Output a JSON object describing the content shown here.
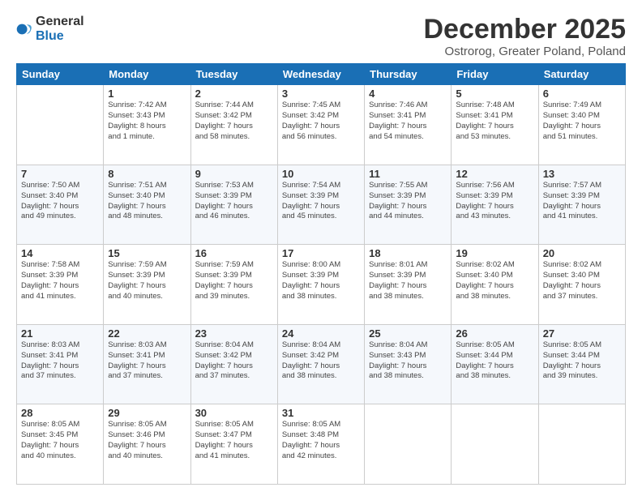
{
  "logo": {
    "general": "General",
    "blue": "Blue"
  },
  "title": "December 2025",
  "subtitle": "Ostrorog, Greater Poland, Poland",
  "days_of_week": [
    "Sunday",
    "Monday",
    "Tuesday",
    "Wednesday",
    "Thursday",
    "Friday",
    "Saturday"
  ],
  "weeks": [
    [
      {
        "day": "",
        "info": ""
      },
      {
        "day": "1",
        "info": "Sunrise: 7:42 AM\nSunset: 3:43 PM\nDaylight: 8 hours\nand 1 minute."
      },
      {
        "day": "2",
        "info": "Sunrise: 7:44 AM\nSunset: 3:42 PM\nDaylight: 7 hours\nand 58 minutes."
      },
      {
        "day": "3",
        "info": "Sunrise: 7:45 AM\nSunset: 3:42 PM\nDaylight: 7 hours\nand 56 minutes."
      },
      {
        "day": "4",
        "info": "Sunrise: 7:46 AM\nSunset: 3:41 PM\nDaylight: 7 hours\nand 54 minutes."
      },
      {
        "day": "5",
        "info": "Sunrise: 7:48 AM\nSunset: 3:41 PM\nDaylight: 7 hours\nand 53 minutes."
      },
      {
        "day": "6",
        "info": "Sunrise: 7:49 AM\nSunset: 3:40 PM\nDaylight: 7 hours\nand 51 minutes."
      }
    ],
    [
      {
        "day": "7",
        "info": "Sunrise: 7:50 AM\nSunset: 3:40 PM\nDaylight: 7 hours\nand 49 minutes."
      },
      {
        "day": "8",
        "info": "Sunrise: 7:51 AM\nSunset: 3:40 PM\nDaylight: 7 hours\nand 48 minutes."
      },
      {
        "day": "9",
        "info": "Sunrise: 7:53 AM\nSunset: 3:39 PM\nDaylight: 7 hours\nand 46 minutes."
      },
      {
        "day": "10",
        "info": "Sunrise: 7:54 AM\nSunset: 3:39 PM\nDaylight: 7 hours\nand 45 minutes."
      },
      {
        "day": "11",
        "info": "Sunrise: 7:55 AM\nSunset: 3:39 PM\nDaylight: 7 hours\nand 44 minutes."
      },
      {
        "day": "12",
        "info": "Sunrise: 7:56 AM\nSunset: 3:39 PM\nDaylight: 7 hours\nand 43 minutes."
      },
      {
        "day": "13",
        "info": "Sunrise: 7:57 AM\nSunset: 3:39 PM\nDaylight: 7 hours\nand 41 minutes."
      }
    ],
    [
      {
        "day": "14",
        "info": "Sunrise: 7:58 AM\nSunset: 3:39 PM\nDaylight: 7 hours\nand 41 minutes."
      },
      {
        "day": "15",
        "info": "Sunrise: 7:59 AM\nSunset: 3:39 PM\nDaylight: 7 hours\nand 40 minutes."
      },
      {
        "day": "16",
        "info": "Sunrise: 7:59 AM\nSunset: 3:39 PM\nDaylight: 7 hours\nand 39 minutes."
      },
      {
        "day": "17",
        "info": "Sunrise: 8:00 AM\nSunset: 3:39 PM\nDaylight: 7 hours\nand 38 minutes."
      },
      {
        "day": "18",
        "info": "Sunrise: 8:01 AM\nSunset: 3:39 PM\nDaylight: 7 hours\nand 38 minutes."
      },
      {
        "day": "19",
        "info": "Sunrise: 8:02 AM\nSunset: 3:40 PM\nDaylight: 7 hours\nand 38 minutes."
      },
      {
        "day": "20",
        "info": "Sunrise: 8:02 AM\nSunset: 3:40 PM\nDaylight: 7 hours\nand 37 minutes."
      }
    ],
    [
      {
        "day": "21",
        "info": "Sunrise: 8:03 AM\nSunset: 3:41 PM\nDaylight: 7 hours\nand 37 minutes."
      },
      {
        "day": "22",
        "info": "Sunrise: 8:03 AM\nSunset: 3:41 PM\nDaylight: 7 hours\nand 37 minutes."
      },
      {
        "day": "23",
        "info": "Sunrise: 8:04 AM\nSunset: 3:42 PM\nDaylight: 7 hours\nand 37 minutes."
      },
      {
        "day": "24",
        "info": "Sunrise: 8:04 AM\nSunset: 3:42 PM\nDaylight: 7 hours\nand 38 minutes."
      },
      {
        "day": "25",
        "info": "Sunrise: 8:04 AM\nSunset: 3:43 PM\nDaylight: 7 hours\nand 38 minutes."
      },
      {
        "day": "26",
        "info": "Sunrise: 8:05 AM\nSunset: 3:44 PM\nDaylight: 7 hours\nand 38 minutes."
      },
      {
        "day": "27",
        "info": "Sunrise: 8:05 AM\nSunset: 3:44 PM\nDaylight: 7 hours\nand 39 minutes."
      }
    ],
    [
      {
        "day": "28",
        "info": "Sunrise: 8:05 AM\nSunset: 3:45 PM\nDaylight: 7 hours\nand 40 minutes."
      },
      {
        "day": "29",
        "info": "Sunrise: 8:05 AM\nSunset: 3:46 PM\nDaylight: 7 hours\nand 40 minutes."
      },
      {
        "day": "30",
        "info": "Sunrise: 8:05 AM\nSunset: 3:47 PM\nDaylight: 7 hours\nand 41 minutes."
      },
      {
        "day": "31",
        "info": "Sunrise: 8:05 AM\nSunset: 3:48 PM\nDaylight: 7 hours\nand 42 minutes."
      },
      {
        "day": "",
        "info": ""
      },
      {
        "day": "",
        "info": ""
      },
      {
        "day": "",
        "info": ""
      }
    ]
  ]
}
